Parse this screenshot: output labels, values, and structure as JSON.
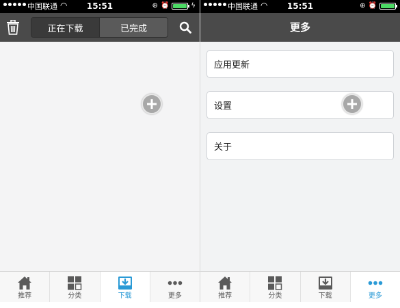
{
  "status_bar": {
    "carrier": "中国联通",
    "time": "15:51"
  },
  "left_screen": {
    "segmented_control": {
      "active_label": "正在下载",
      "inactive_label": "已完成"
    },
    "icons": {
      "left": "trash-icon",
      "right": "search-icon",
      "floating": "add-icon"
    }
  },
  "right_screen": {
    "title": "更多",
    "menu_items": [
      {
        "label": "应用更新"
      },
      {
        "label": "设置"
      },
      {
        "label": "关于"
      }
    ]
  },
  "tab_bar": {
    "tabs": [
      {
        "label": "推荐",
        "icon": "home-icon"
      },
      {
        "label": "分类",
        "icon": "grid-icon"
      },
      {
        "label": "下载",
        "icon": "download-icon"
      },
      {
        "label": "更多",
        "icon": "more-icon"
      }
    ],
    "left_active_index": 2,
    "right_active_index": 3
  },
  "colors": {
    "nav_bar": "#4a4a4a",
    "accent_active": "#2a9ad6",
    "battery": "#4cd964",
    "tab_inactive": "#5a5a5a"
  }
}
